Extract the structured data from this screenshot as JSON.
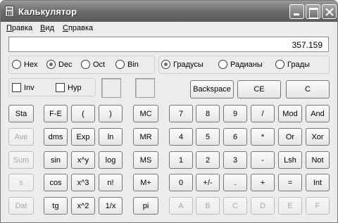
{
  "window": {
    "title": "Калькулятор",
    "icon": "calculator-icon"
  },
  "menu": [
    "Правка",
    "Вид",
    "Справка"
  ],
  "display": {
    "value": "357.159"
  },
  "number_system": [
    {
      "label": "Hex",
      "checked": false
    },
    {
      "label": "Dec",
      "checked": true
    },
    {
      "label": "Oct",
      "checked": false
    },
    {
      "label": "Bin",
      "checked": false
    }
  ],
  "angle_units": [
    {
      "label": "Градусы",
      "checked": true
    },
    {
      "label": "Радианы",
      "checked": false
    },
    {
      "label": "Грады",
      "checked": false
    }
  ],
  "checks": [
    {
      "label": "Inv",
      "checked": false
    },
    {
      "label": "Hyp",
      "checked": false
    }
  ],
  "edit_buttons": {
    "backspace": "Backspace",
    "ce": "CE",
    "c": "C"
  },
  "stat_buttons": [
    "Sta",
    "Ave",
    "Sum",
    "s",
    "Dat"
  ],
  "sci_col1": [
    "F-E",
    "dms",
    "sin",
    "cos",
    "tg"
  ],
  "sci_col2": [
    "(",
    "Exp",
    "x^y",
    "x^3",
    "x^2"
  ],
  "sci_col3": [
    ")",
    "ln",
    "log",
    "n!",
    "1/x"
  ],
  "memory_buttons": [
    "MC",
    "MR",
    "MS",
    "M+",
    "pi"
  ],
  "keypad": [
    [
      "7",
      "8",
      "9",
      "/",
      "Mod",
      "And"
    ],
    [
      "4",
      "5",
      "6",
      "*",
      "Or",
      "Xor"
    ],
    [
      "1",
      "2",
      "3",
      "-",
      "Lsh",
      "Not"
    ],
    [
      "0",
      "+/-",
      ".",
      "+",
      "=",
      "Int"
    ],
    [
      "A",
      "B",
      "C",
      "D",
      "E",
      "F"
    ]
  ],
  "colors": {
    "titlebar": "#6c6c6c",
    "window_bg": "#ececec",
    "disabled_text": "#a8a8a8"
  }
}
